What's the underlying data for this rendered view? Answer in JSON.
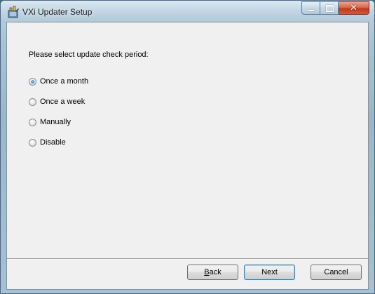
{
  "window": {
    "title": "VXi Updater Setup",
    "icon": "installer-icon",
    "controls": {
      "minimize": "minimize-icon",
      "maximize": "maximize-icon",
      "close": "close-icon"
    }
  },
  "content": {
    "prompt": "Please select update check period:",
    "options": [
      {
        "label": "Once a month",
        "checked": true
      },
      {
        "label": "Once a week",
        "checked": false
      },
      {
        "label": "Manually",
        "checked": false
      },
      {
        "label": "Disable",
        "checked": false
      }
    ]
  },
  "buttons": {
    "back_mnemonic": "B",
    "back_rest": "ack",
    "next": "Next",
    "cancel": "Cancel"
  },
  "colors": {
    "accent": "#2f8fd0",
    "close_button": "#c0391b",
    "titlebar": "#c3d7e4",
    "client_bg": "#f0f0f0"
  }
}
